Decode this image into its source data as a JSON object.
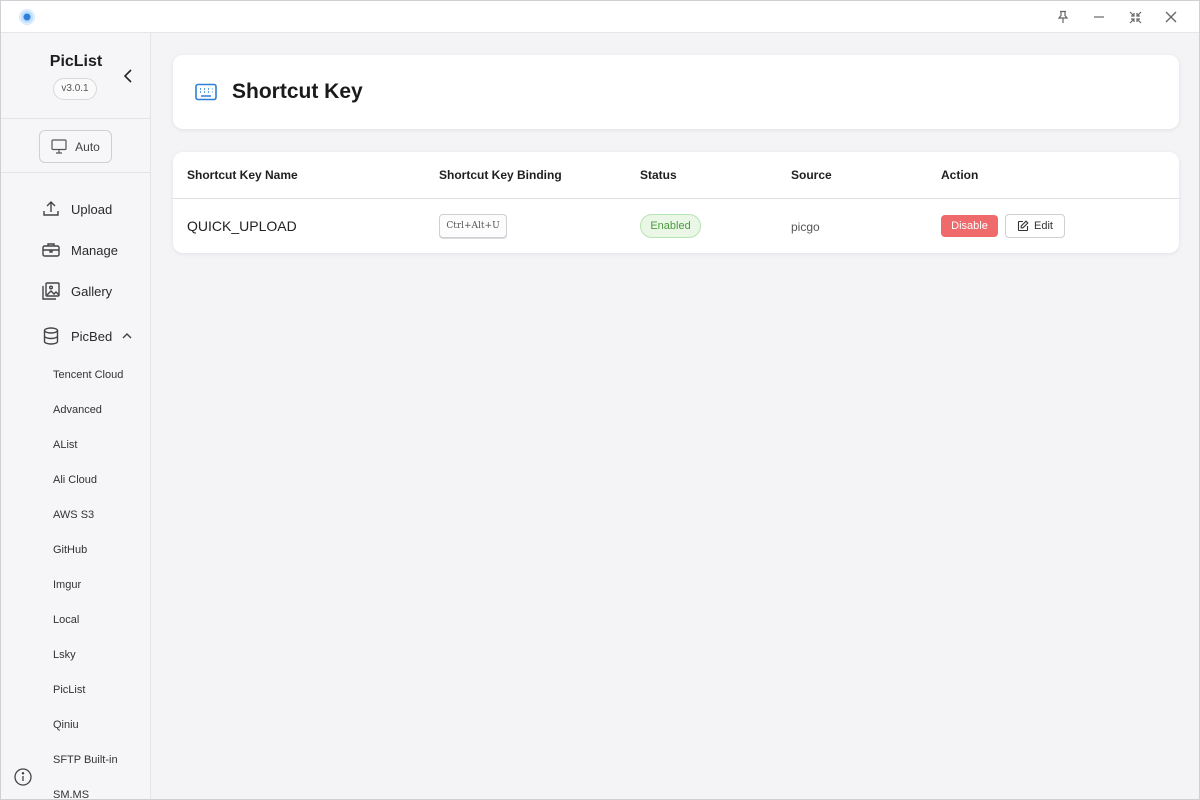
{
  "window": {
    "pin_icon": "pin-icon",
    "minimize_icon": "minimize-icon",
    "restore_icon": "restore-icon",
    "close_icon": "close-icon"
  },
  "sidebar": {
    "app_name": "PicList",
    "version": "v3.0.1",
    "theme_label": "Auto",
    "nav": [
      {
        "label": "Upload",
        "icon": "upload-icon"
      },
      {
        "label": "Manage",
        "icon": "briefcase-icon"
      },
      {
        "label": "Gallery",
        "icon": "gallery-icon"
      },
      {
        "label": "PicBed",
        "icon": "database-icon",
        "expanded": true
      }
    ],
    "picbeds": [
      "Tencent Cloud",
      "Advanced",
      "AList",
      "Ali Cloud",
      "AWS S3",
      "GitHub",
      "Imgur",
      "Local",
      "Lsky",
      "PicList",
      "Qiniu",
      "SFTP Built-in",
      "SM.MS"
    ]
  },
  "header": {
    "title": "Shortcut Key",
    "icon": "keyboard-icon"
  },
  "table": {
    "columns": [
      "Shortcut Key Name",
      "Shortcut Key Binding",
      "Status",
      "Source",
      "Action"
    ],
    "rows": [
      {
        "name": "QUICK_UPLOAD",
        "binding": "Ctrl+Alt+U",
        "status": "Enabled",
        "source": "picgo",
        "disable_label": "Disable",
        "edit_label": "Edit"
      }
    ]
  },
  "colors": {
    "accent": "#2f7fd8",
    "enabled_green": "#4a9a3f",
    "disable_red": "#ef6a6a"
  }
}
